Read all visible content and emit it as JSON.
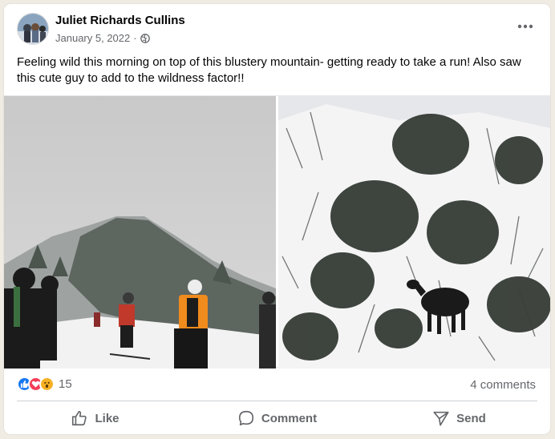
{
  "post": {
    "author": "Juliet Richards Cullins",
    "date": "January 5, 2022",
    "separator": "·",
    "privacy_icon": "globe-icon",
    "caption": "Feeling wild this morning on top of this blustery mountain- getting ready to take a run! Also saw this cute guy to add to the wildness factor!!",
    "photos": [
      {
        "name": "ski-slope-photo",
        "description_icon": "photo"
      },
      {
        "name": "moose-photo",
        "description_icon": "photo"
      }
    ]
  },
  "stats": {
    "reactions": [
      "like-reaction-icon",
      "love-reaction-icon",
      "wow-reaction-icon"
    ],
    "reaction_count": "15",
    "comments": "4 comments"
  },
  "actions": {
    "like": "Like",
    "comment": "Comment",
    "send": "Send"
  },
  "colors": {
    "like_blue": "#1877f2",
    "love_red": "#f33e58",
    "wow_yellow": "#f7b125",
    "muted_text": "#65676b"
  }
}
